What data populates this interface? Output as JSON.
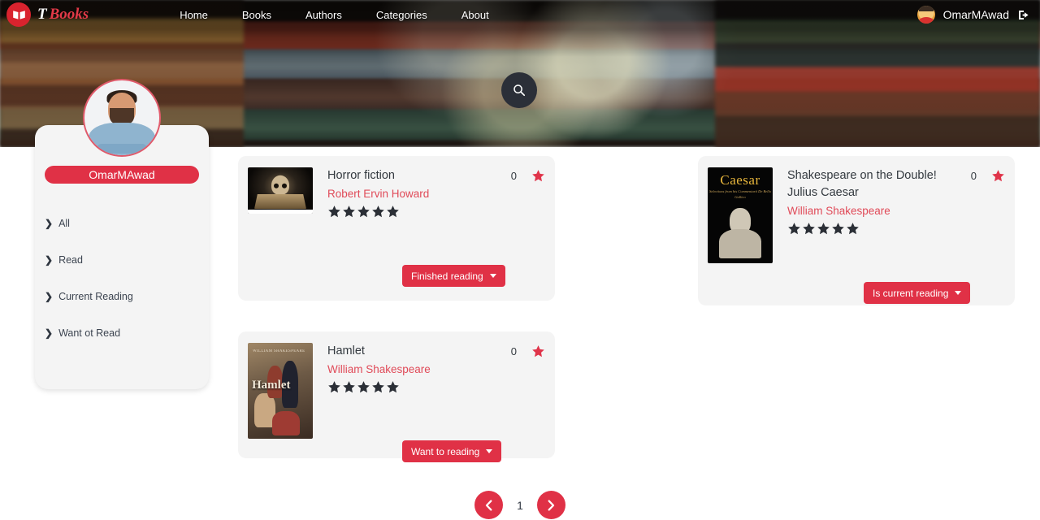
{
  "brand": {
    "mark": "open-book-icon",
    "text_primary": "T",
    "text_secondary": "Books"
  },
  "nav": {
    "links": [
      {
        "label": "Home"
      },
      {
        "label": "Books"
      },
      {
        "label": "Authors"
      },
      {
        "label": "Categories"
      },
      {
        "label": "About"
      }
    ],
    "user": "OmarMAwad",
    "avatar_icon": "user-avatar-icon",
    "logout_icon": "logout-icon"
  },
  "hero": {
    "search_icon": "search-icon",
    "profile_photo_alt": "profile-photo"
  },
  "sidebar": {
    "username": "OmarMAwad",
    "items": [
      {
        "label": "All",
        "icon": "chevron-right-icon"
      },
      {
        "label": "Read",
        "icon": "chevron-right-icon"
      },
      {
        "label": "Current Reading",
        "icon": "chevron-right-icon"
      },
      {
        "label": "Want ot Read",
        "icon": "chevron-right-icon"
      }
    ]
  },
  "books": [
    {
      "title": "Horror fiction",
      "author": "Robert Ervin Howard",
      "fav_count": "0",
      "fav_icon": "star-filled-icon",
      "rating": 5,
      "status_label": "Finished reading",
      "cover": "skull-on-book-cover",
      "cover_shape": "wide"
    },
    {
      "title": "Hamlet",
      "author": "William Shakespeare",
      "fav_count": "0",
      "fav_icon": "star-filled-icon",
      "rating": 5,
      "status_label": "Want to reading",
      "cover": "hamlet-painting-cover",
      "cover_shape": "tall",
      "cover_title": "Hamlet",
      "cover_top_line": "WILLIAM SHAKESPEARE"
    },
    {
      "title": "Shakespeare on the Double! Julius Caesar",
      "author": "William Shakespeare",
      "fav_count": "0",
      "fav_icon": "star-filled-icon",
      "rating": 5,
      "status_label": "Is current reading",
      "cover": "caesar-bust-cover",
      "cover_shape": "tall",
      "cover_title": "Caesar",
      "cover_sub": "Selections from his Commentarii De Bello Gallico"
    }
  ],
  "pagination": {
    "prev_icon": "chevron-left-circle-icon",
    "next_icon": "chevron-right-circle-icon",
    "current_page": "1"
  },
  "colors": {
    "brand_red": "#e03146",
    "author_red": "#e04a58",
    "star_dark": "#2b2f36",
    "card_bg": "#f4f4f4",
    "search_btn": "#2b2f38"
  }
}
